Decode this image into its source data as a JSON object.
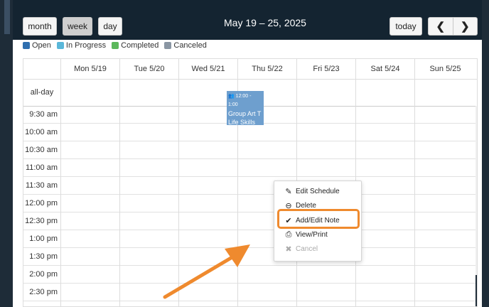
{
  "toolbar": {
    "views": [
      "month",
      "week",
      "day"
    ],
    "active_view": "week",
    "date_range": "May 19 – 25, 2025",
    "today_label": "today",
    "prev_glyph": "❮",
    "next_glyph": "❯"
  },
  "legend": [
    {
      "label": "Open",
      "color": "#2f6faf"
    },
    {
      "label": "In Progress",
      "color": "#5ab7d9"
    },
    {
      "label": "Completed",
      "color": "#5cb85c"
    },
    {
      "label": "Canceled",
      "color": "#8a96a3"
    }
  ],
  "calendar": {
    "days": [
      "Mon 5/19",
      "Tue 5/20",
      "Wed 5/21",
      "Thu 5/22",
      "Fri 5/23",
      "Sat 5/24",
      "Sun 5/25"
    ],
    "allday_label": "all-day",
    "times": [
      "9:30 am",
      "10:00 am",
      "10:30 am",
      "11:00 am",
      "11:30 am",
      "12:00 pm",
      "12:30 pm",
      "1:00 pm",
      "1:30 pm",
      "2:00 pm",
      "2:30 pm"
    ]
  },
  "event": {
    "time": "12:00 - 1:00",
    "title": "Group Art T",
    "subtitle": "Life Skills",
    "status_color": "#6e9fce"
  },
  "context_menu": {
    "items": [
      {
        "label": "Edit Schedule",
        "icon": "edit-icon",
        "glyph": "✎",
        "enabled": true
      },
      {
        "label": "Delete",
        "icon": "delete-icon",
        "glyph": "⊖",
        "enabled": true
      },
      {
        "label": "Add/Edit Note",
        "icon": "check-icon",
        "glyph": "✔",
        "enabled": true
      },
      {
        "label": "View/Print",
        "icon": "print-icon",
        "glyph": "⎙",
        "enabled": true
      },
      {
        "label": "Cancel",
        "icon": "cancel-icon",
        "glyph": "✖",
        "enabled": false
      }
    ],
    "highlight_color": "#ef8a2e"
  }
}
